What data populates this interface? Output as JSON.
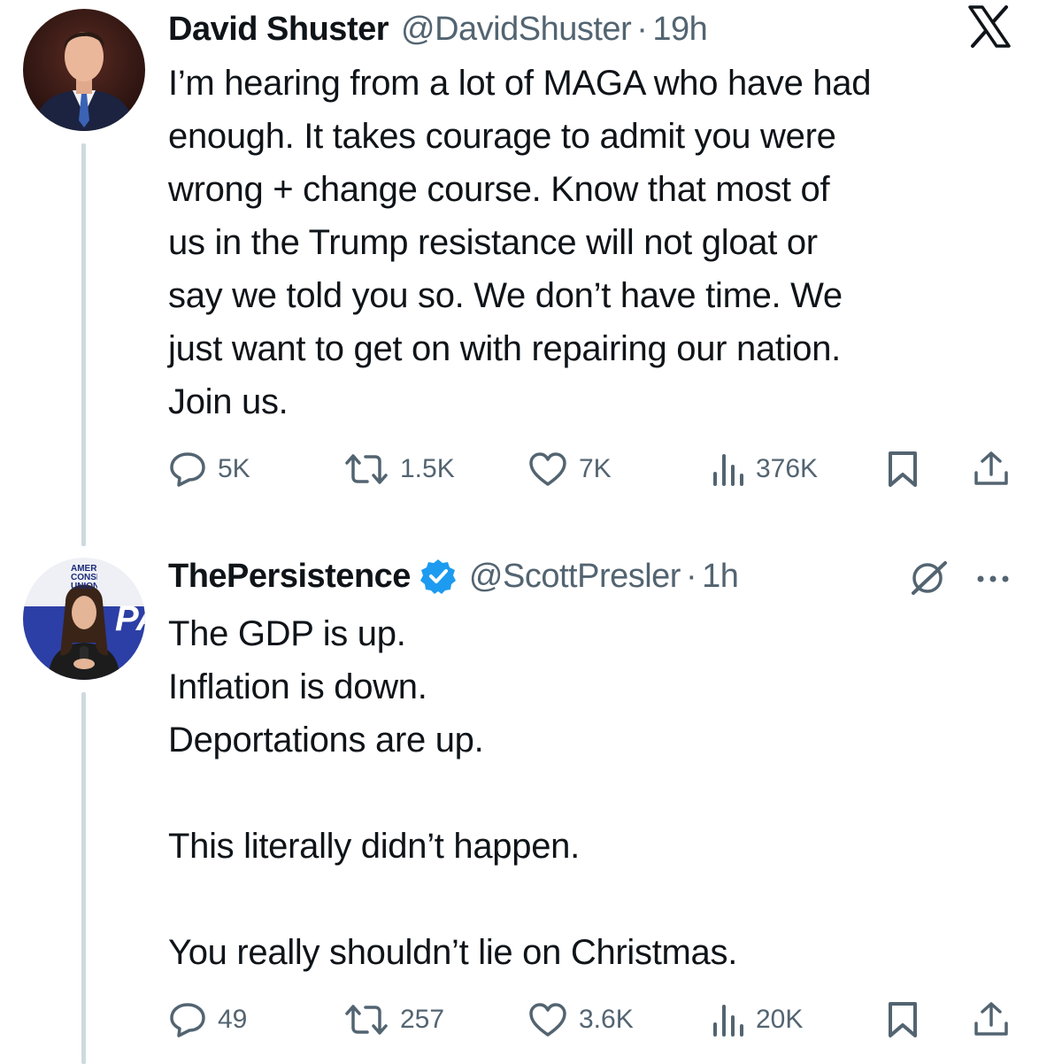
{
  "tweets": [
    {
      "author_name": "David Shuster",
      "handle": "@DavidShuster",
      "separator": "·",
      "time": "19h",
      "text": "I’m hearing from a lot of MAGA who have had\nenough. It takes courage to admit you were\nwrong + change course.  Know that most of\nus in the Trump resistance will not gloat or\nsay we told you so.  We don’t have time. We\njust want to get on with repairing our nation.\nJoin us.",
      "stats": {
        "replies": "5K",
        "reposts": "1.5K",
        "likes": "7K",
        "views": "376K"
      }
    },
    {
      "author_name": "ThePersistence",
      "handle": "@ScottPresler",
      "separator": "·",
      "time": "1h",
      "avatar_text": "AMER\nCONSE\nUNION",
      "text": "The GDP is up.\nInflation is down.\nDeportations are up.\n\nThis literally didn’t happen.\n\nYou really shouldn’t lie on Christmas.",
      "stats": {
        "replies": "49",
        "reposts": "257",
        "likes": "3.6K",
        "views": "20K"
      }
    }
  ],
  "icons": {
    "platform_logo": "x-logo-icon",
    "verified": "verified-badge-icon",
    "grok": "grok-icon",
    "more": "more-icon",
    "reply": "reply-icon",
    "repost": "repost-icon",
    "like": "like-icon",
    "views": "views-icon",
    "bookmark": "bookmark-icon",
    "share": "share-icon"
  },
  "colors": {
    "text": "#0f1419",
    "secondary": "#536471",
    "verified": "#1d9bf0",
    "thread_line": "#cfd9de"
  }
}
